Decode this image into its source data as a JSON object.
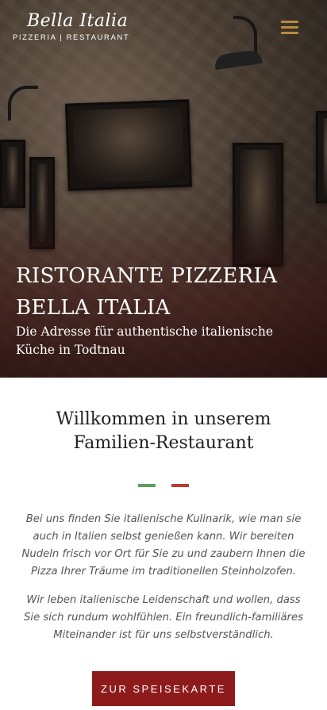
{
  "header": {
    "logo": {
      "script_text": "Bella Italia",
      "tagline": "PIZZERIA | RESTAURANT"
    },
    "menu_icon": "hamburger-menu-icon"
  },
  "hero": {
    "title_line1": "RISTORANTE PIZZERIA",
    "title_line2": "BELLA ITALIA",
    "subtitle": "Die Adresse für authentische italienische Küche in Todtnau"
  },
  "welcome": {
    "title": "Willkommen in unserem Familien-Restaurant",
    "divider_colors": {
      "left": "#5aa05a",
      "right": "#c0392b"
    },
    "paragraph1": "Bei uns finden Sie italienische Kulinarik, wie man sie auch in Italien selbst genießen kann. Wir bereiten Nudeln frisch vor Ort für Sie zu und zaubern Ihnen die Pizza Ihrer Träume im traditionellen Steinholzofen.",
    "paragraph2": "Wir leben italienische Leidenschaft und wollen, dass Sie sich rundum wohlfühlen. Ein freundlich-familiäres Miteinander ist für uns selbstverständlich.",
    "cta_label": "ZUR SPEISEKARTE"
  },
  "colors": {
    "accent_gold": "#b78b3d",
    "button_red": "#8e1b1b"
  }
}
